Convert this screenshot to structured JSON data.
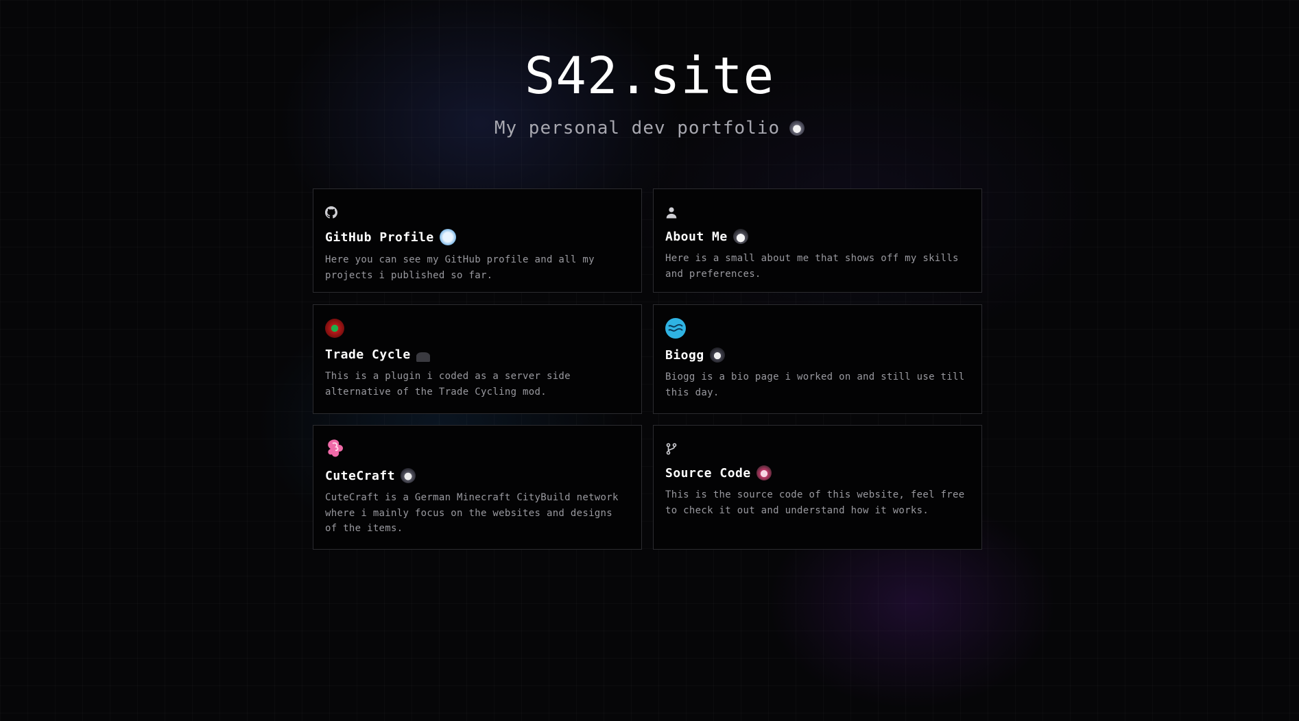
{
  "header": {
    "title": "S42.site",
    "subtitle": "My personal dev portfolio"
  },
  "cards": [
    {
      "title": "GitHub Profile",
      "description": "Here you can see my GitHub profile and all my projects i published so far.",
      "icon": "github-icon"
    },
    {
      "title": "About Me",
      "description": "Here is a small about me that shows off my skills and preferences.",
      "icon": "user-icon"
    },
    {
      "title": "Trade Cycle",
      "description": "This is a plugin i coded as a server side alternative of the Trade Cycling mod.",
      "icon": "trade-cycle-logo-icon"
    },
    {
      "title": "Biogg",
      "description": "Biogg is a bio page i worked on and still use till this day.",
      "icon": "biogg-logo-icon"
    },
    {
      "title": "CuteCraft",
      "description": "CuteCraft is a German Minecraft CityBuild network where i mainly focus on the websites and designs of the items.",
      "icon": "cutecraft-logo-icon"
    },
    {
      "title": "Source Code",
      "description": "This is the source code of this website, feel free to check it out and understand how it works.",
      "icon": "git-branch-icon"
    }
  ],
  "colors": {
    "background": "#060608",
    "card_border": "#2c2c30",
    "text_primary": "#ffffff",
    "text_secondary": "#9a9aa0"
  }
}
